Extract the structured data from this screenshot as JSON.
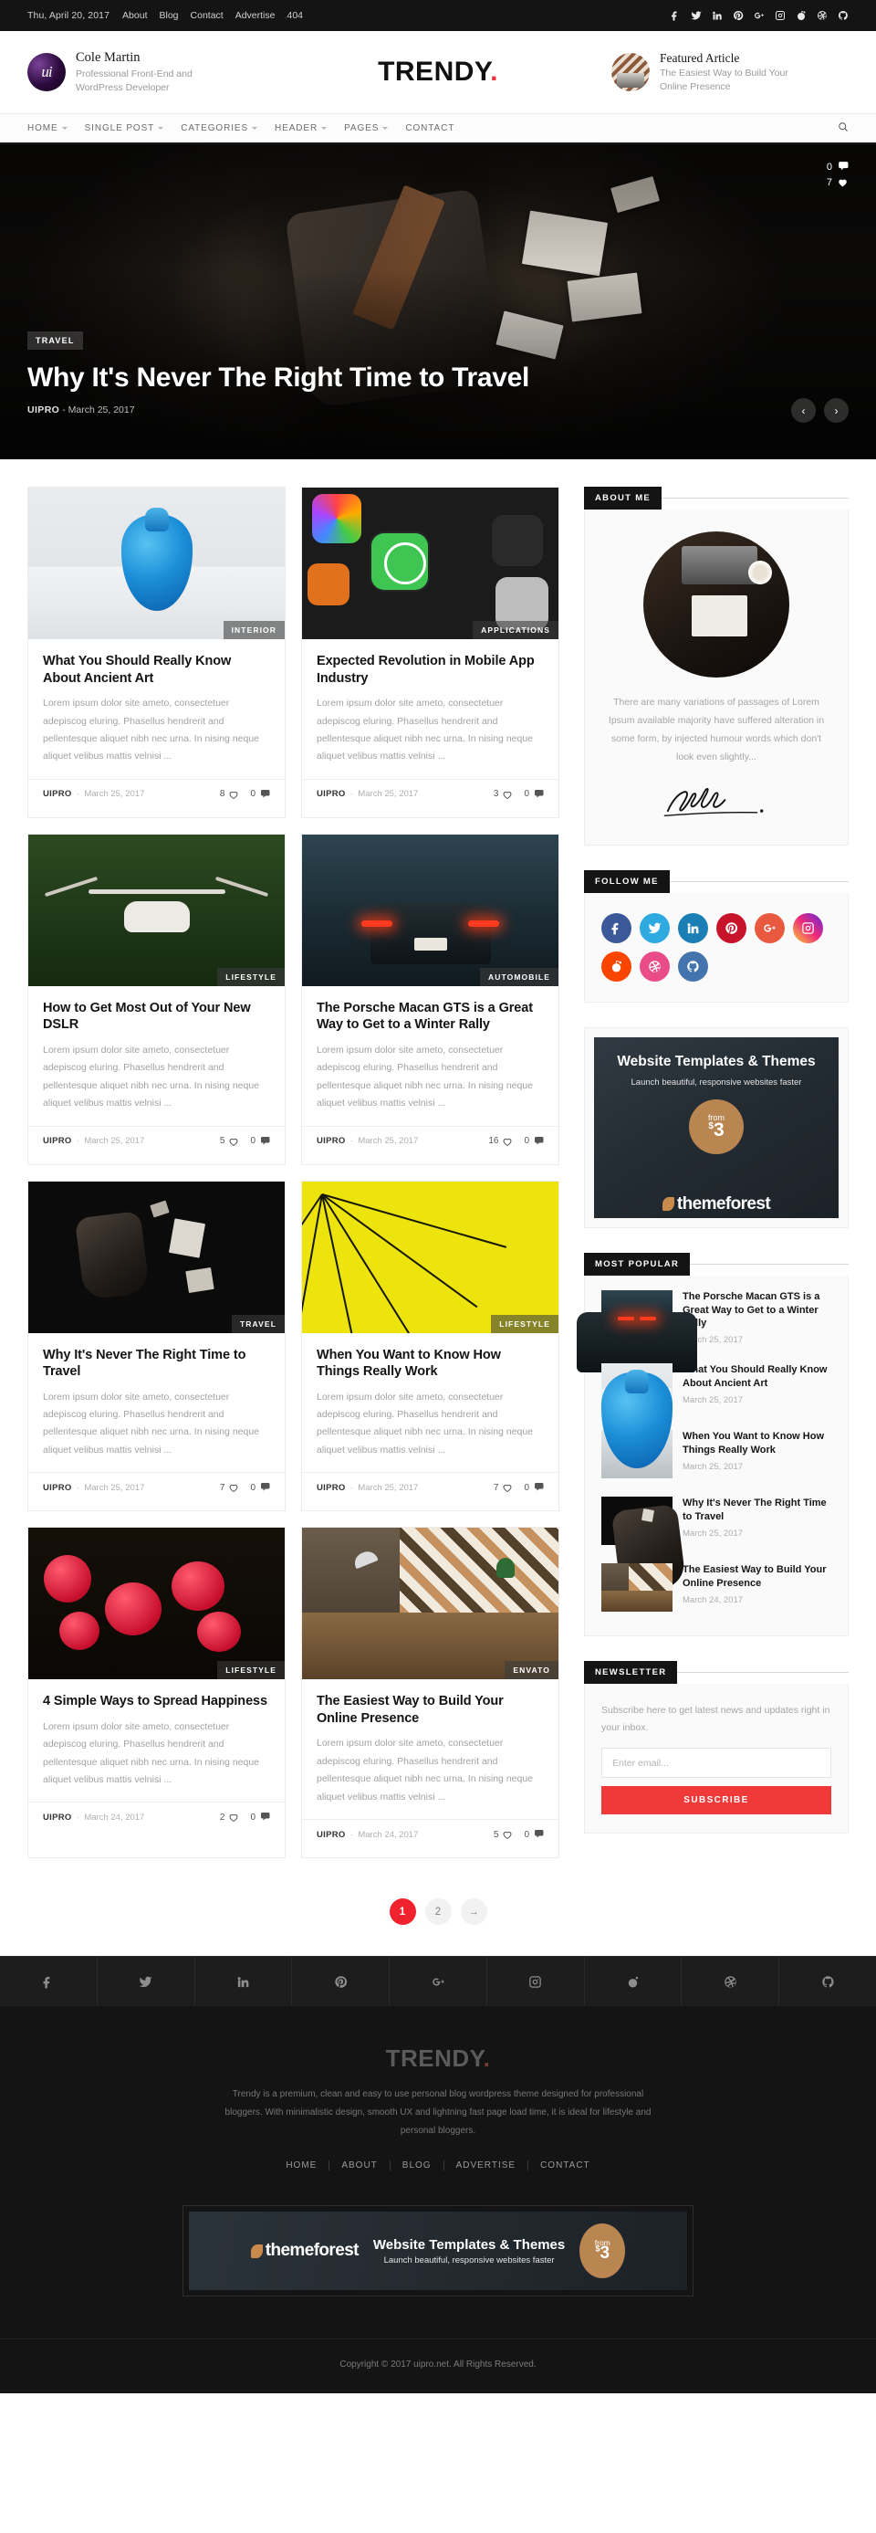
{
  "topbar": {
    "date": "Thu, April 20, 2017",
    "links": [
      "About",
      "Blog",
      "Contact",
      "Advertise",
      "404"
    ],
    "social": [
      "facebook-icon",
      "twitter-icon",
      "linkedin-icon",
      "pinterest-icon",
      "google-plus-icon",
      "instagram-icon",
      "reddit-icon",
      "dribbble-icon",
      "github-icon"
    ]
  },
  "header": {
    "author_name": "Cole Martin",
    "author_role": "Professional Front-End and WordPress Developer",
    "logo": "TRENDY",
    "logo_dot": ".",
    "featured_label": "Featured Article",
    "featured_title": "The Easiest Way to Build Your Online Presence"
  },
  "nav": {
    "items": [
      {
        "label": "HOME",
        "caret": true
      },
      {
        "label": "SINGLE POST",
        "caret": true
      },
      {
        "label": "CATEGORIES",
        "caret": true
      },
      {
        "label": "HEADER",
        "caret": true
      },
      {
        "label": "PAGES",
        "caret": true
      },
      {
        "label": "CONTACT",
        "caret": false
      }
    ],
    "search_icon": "search-icon"
  },
  "hero": {
    "category": "TRAVEL",
    "title": "Why It's Never The Right Time to Travel",
    "author": "UIPRO",
    "sep": "-",
    "date": "March 25, 2017",
    "comments": "0",
    "likes": "7",
    "prev": "‹",
    "next": "›"
  },
  "posts": [
    {
      "category": "INTERIOR",
      "title": "What You Should Really Know About Ancient Art",
      "excerpt": "Lorem ipsum dolor site ameto, consectetuer adepiscog eluring. Phasellus hendrerit and pellentesque aliquet nibh nec urna. In nising neque aliquet velibus mattis velnisi ...",
      "author": "UIPRO",
      "date": "March 25, 2017",
      "likes": "8",
      "comments": "0"
    },
    {
      "category": "APPLICATIONS",
      "title": "Expected Revolution in Mobile App Industry",
      "excerpt": "Lorem ipsum dolor site ameto, consectetuer adepiscog eluring. Phasellus hendrerit and pellentesque aliquet nibh nec urna. In nising neque aliquet velibus mattis velnisi ...",
      "author": "UIPRO",
      "date": "March 25, 2017",
      "likes": "3",
      "comments": "0"
    },
    {
      "category": "LIFESTYLE",
      "title": "How to Get Most Out of Your New DSLR",
      "excerpt": "Lorem ipsum dolor site ameto, consectetuer adepiscog eluring. Phasellus hendrerit and pellentesque aliquet nibh nec urna. In nising neque aliquet velibus mattis velnisi ...",
      "author": "UIPRO",
      "date": "March 25, 2017",
      "likes": "5",
      "comments": "0"
    },
    {
      "category": "AUTOMOBILE",
      "title": "The Porsche Macan GTS is a Great Way to Get to a Winter Rally",
      "excerpt": "Lorem ipsum dolor site ameto, consectetuer adepiscog eluring. Phasellus hendrerit and pellentesque aliquet nibh nec urna. In nising neque aliquet velibus mattis velnisi ...",
      "author": "UIPRO",
      "date": "March 25, 2017",
      "likes": "16",
      "comments": "0"
    },
    {
      "category": "TRAVEL",
      "title": "Why It's Never The Right Time to Travel",
      "excerpt": "Lorem ipsum dolor site ameto, consectetuer adepiscog eluring. Phasellus hendrerit and pellentesque aliquet nibh nec urna. In nising neque aliquet velibus mattis velnisi ...",
      "author": "UIPRO",
      "date": "March 25, 2017",
      "likes": "7",
      "comments": "0"
    },
    {
      "category": "LIFESTYLE",
      "title": "When You Want to Know How Things Really Work",
      "excerpt": "Lorem ipsum dolor site ameto, consectetuer adepiscog eluring. Phasellus hendrerit and pellentesque aliquet nibh nec urna. In nising neque aliquet velibus mattis velnisi ...",
      "author": "UIPRO",
      "date": "March 25, 2017",
      "likes": "7",
      "comments": "0"
    },
    {
      "category": "LIFESTYLE",
      "title": "4 Simple Ways to Spread Happiness",
      "excerpt": "Lorem ipsum dolor site ameto, consectetuer adepiscog eluring. Phasellus hendrerit and pellentesque aliquet nibh nec urna. In nising neque aliquet velibus mattis velnisi ...",
      "author": "UIPRO",
      "date": "March 24, 2017",
      "likes": "2",
      "comments": "0"
    },
    {
      "category": "ENVATO",
      "title": "The Easiest Way to Build Your Online Presence",
      "excerpt": "Lorem ipsum dolor site ameto, consectetuer adepiscog eluring. Phasellus hendrerit and pellentesque aliquet nibh nec urna. In nising neque aliquet velibus mattis velnisi ...",
      "author": "UIPRO",
      "date": "March 24, 2017",
      "likes": "5",
      "comments": "0"
    }
  ],
  "sidebar": {
    "about": {
      "title": "ABOUT ME",
      "text": "There are many variations of passages of Lorem Ipsum available majority have suffered alteration in some form, by injected humour words which don't look even slightly...",
      "signature": "Lara Croft"
    },
    "follow": {
      "title": "FOLLOW ME",
      "networks": [
        {
          "name": "facebook-icon",
          "color": "#3b5998"
        },
        {
          "name": "twitter-icon",
          "color": "#2eaae1"
        },
        {
          "name": "linkedin-icon",
          "color": "#1b7fb5"
        },
        {
          "name": "pinterest-icon",
          "color": "#c8142a"
        },
        {
          "name": "google-plus-icon",
          "color": "#e8593f"
        },
        {
          "name": "instagram-icon",
          "color": "#d6249f"
        },
        {
          "name": "reddit-icon",
          "color": "#fa4500"
        },
        {
          "name": "dribbble-icon",
          "color": "#ea4c89"
        },
        {
          "name": "github-icon",
          "color": "#4474ad"
        }
      ]
    },
    "ad": {
      "heading": "Website Templates & Themes",
      "sub": "Launch beautiful, responsive websites faster",
      "from": "from",
      "price_sym": "$",
      "price": "3",
      "brand": "themeforest"
    },
    "popular": {
      "title": "MOST POPULAR",
      "items": [
        {
          "title": "The Porsche Macan GTS is a Great Way to Get to a Winter Rally",
          "date": "March 25, 2017"
        },
        {
          "title": "What You Should Really Know About Ancient Art",
          "date": "March 25, 2017"
        },
        {
          "title": "When You Want to Know How Things Really Work",
          "date": "March 25, 2017"
        },
        {
          "title": "Why It's Never The Right Time to Travel",
          "date": "March 25, 2017"
        },
        {
          "title": "The Easiest Way to Build Your Online Presence",
          "date": "March 24, 2017"
        }
      ]
    },
    "newsletter": {
      "title": "NEWSLETTER",
      "text": "Subscribe here to get latest news and updates right in your inbox.",
      "placeholder": "Enter email...",
      "button": "SUBSCRIBE"
    }
  },
  "pagination": {
    "pages": [
      "1",
      "2",
      "→"
    ],
    "active": "1"
  },
  "footer": {
    "social": [
      "facebook-icon",
      "twitter-icon",
      "linkedin-icon",
      "pinterest-icon",
      "google-plus-icon",
      "instagram-icon",
      "reddit-icon",
      "dribbble-icon",
      "github-icon"
    ],
    "logo": "TRENDY",
    "logo_dot": ".",
    "about": "Trendy is a premium, clean and easy to use personal blog wordpress theme designed for professional bloggers. With minimalistic design, smooth UX and lightning fast page load time, it is ideal for lifestyle and personal bloggers.",
    "nav": [
      "HOME",
      "ABOUT",
      "BLOG",
      "ADVERTISE",
      "CONTACT"
    ],
    "ad": {
      "brand": "themeforest",
      "heading": "Website Templates & Themes",
      "sub": "Launch beautiful, responsive websites faster",
      "from": "from",
      "price_sym": "$",
      "price": "3"
    },
    "copyright": "Copyright © 2017 uipro.net. All Rights Reserved."
  },
  "colors": {
    "accent": "#f0222d",
    "dark": "#141414",
    "muted": "#a6a6a6"
  }
}
